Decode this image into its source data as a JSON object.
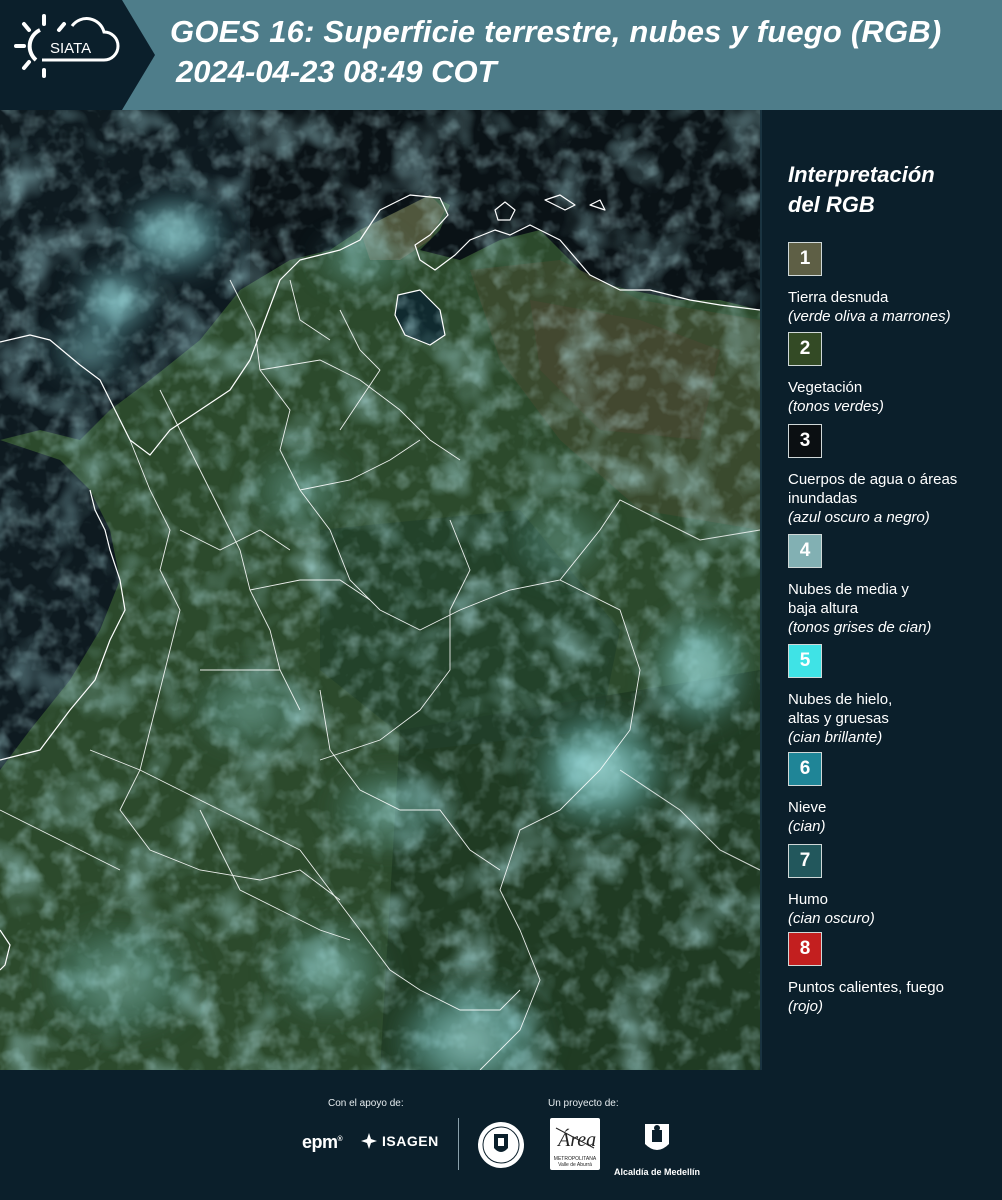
{
  "header": {
    "logo_text": "SIATA",
    "title_line1": "GOES 16: Superficie terrestre, nubes y fuego (RGB)",
    "title_line2": "2024-04-23 08:49 COT",
    "colors": {
      "bar": "#4e7d8a",
      "logo_bg": "#0b1f2b"
    }
  },
  "legend": {
    "title": "Interpretación del RGB",
    "items": [
      {
        "number": "1",
        "label": "Tierra desnuda",
        "note": "(verde oliva a marrones)",
        "color": "#5e5f45"
      },
      {
        "number": "2",
        "label": "Vegetación",
        "note": "(tonos verdes)",
        "color": "#334a25"
      },
      {
        "number": "3",
        "label": "Cuerpos de agua o áreas inundadas",
        "note": "(azul oscuro a negro)",
        "color": "#0b0f12"
      },
      {
        "number": "4",
        "label": "Nubes de media y baja altura",
        "note": "(tonos grises de cian)",
        "color": "#82b0b3"
      },
      {
        "number": "5",
        "label": "Nubes de hielo, altas y gruesas",
        "note": "(cian brillante)",
        "color": "#3fe3e6"
      },
      {
        "number": "6",
        "label": "Nieve",
        "note": "(cian)",
        "color": "#1f8597"
      },
      {
        "number": "7",
        "label": "Humo",
        "note": "(cian oscuro)",
        "color": "#22575c"
      },
      {
        "number": "8",
        "label": "Puntos calientes, fuego",
        "note": "(rojo)",
        "color": "#c31f1f"
      }
    ]
  },
  "footer": {
    "support_label": "Con el apoyo de:",
    "project_label": "Un proyecto de:",
    "epm": "epm",
    "isagen": "ISAGEN",
    "area_text": "METROPOLITANA Valle de Aburrá",
    "area_script": "Área",
    "alcaldia": "Alcaldía de Medellín"
  }
}
